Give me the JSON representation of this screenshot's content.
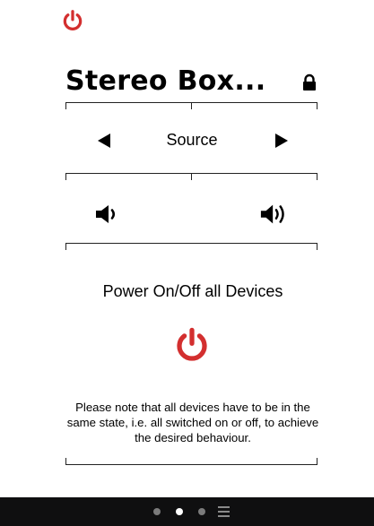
{
  "header": {
    "power_icon": "power-icon",
    "title": "Stereo Box...",
    "lock_icon": "lock-icon"
  },
  "source": {
    "label": "Source",
    "prev_icon": "left-triangle-icon",
    "next_icon": "right-triangle-icon"
  },
  "volume": {
    "down_icon": "volume-down-icon",
    "up_icon": "volume-up-icon"
  },
  "power_all": {
    "label": "Power On/Off all Devices",
    "icon": "power-icon"
  },
  "note": {
    "text": "Please note that all devices have to be in the same state, i.e. all switched on or off, to achieve the desired behaviour."
  },
  "pager": {
    "pages": 3,
    "active_index": 1,
    "menu_icon": "menu-icon"
  },
  "colors": {
    "power_red": "#d32f2f",
    "bottom_bar": "#0f0f10",
    "dot_inactive": "#7b7b7b",
    "dot_active": "#ffffff"
  }
}
